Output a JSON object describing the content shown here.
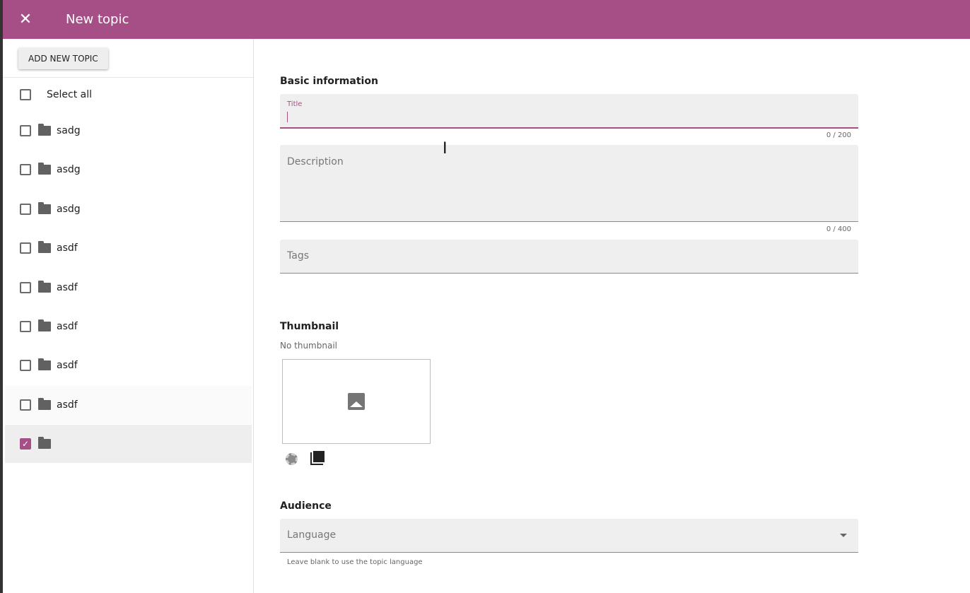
{
  "header": {
    "title": "New topic"
  },
  "sidebar": {
    "add_button": "ADD NEW TOPIC",
    "select_all": "Select all",
    "items": [
      {
        "label": "sadg",
        "checked": false
      },
      {
        "label": "asdg",
        "checked": false
      },
      {
        "label": "asdg",
        "checked": false
      },
      {
        "label": "asdf",
        "checked": false
      },
      {
        "label": "asdf",
        "checked": false
      },
      {
        "label": "asdf",
        "checked": false
      },
      {
        "label": "asdf",
        "checked": false
      },
      {
        "label": "asdf",
        "checked": false
      },
      {
        "label": "",
        "checked": true
      }
    ]
  },
  "form": {
    "basic_heading": "Basic information",
    "title_label": "Title",
    "title_value": "",
    "title_count": "0 / 200",
    "description_placeholder": "Description",
    "description_count": "0 / 400",
    "tags_placeholder": "Tags",
    "thumbnail_heading": "Thumbnail",
    "no_thumbnail": "No thumbnail",
    "audience_heading": "Audience",
    "language_placeholder": "Language",
    "language_hint": "Leave blank to use the topic language"
  },
  "colors": {
    "accent": "#a64f87"
  }
}
